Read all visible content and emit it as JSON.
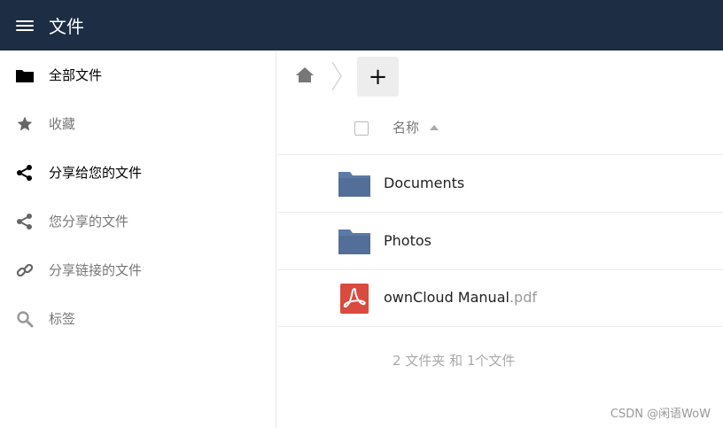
{
  "header": {
    "menu_icon": "hamburger-menu-icon",
    "title": "文件",
    "bg_color": "#1d2d44"
  },
  "sidebar": {
    "items": [
      {
        "label": "全部文件",
        "icon": "folder-icon",
        "state": "active"
      },
      {
        "label": "收藏",
        "icon": "star-icon",
        "state": "muted"
      },
      {
        "label": "分享给您的文件",
        "icon": "share-icon",
        "state": "active"
      },
      {
        "label": "您分享的文件",
        "icon": "share-icon",
        "state": "muted"
      },
      {
        "label": "分享链接的文件",
        "icon": "link-icon",
        "state": "muted"
      },
      {
        "label": "标签",
        "icon": "search-icon",
        "state": "muted"
      }
    ]
  },
  "toolbar": {
    "home_icon": "home-icon",
    "new_label": "+"
  },
  "table": {
    "name_header": "名称",
    "sort": "ascending",
    "rows": [
      {
        "name": "Documents",
        "ext": "",
        "type": "folder",
        "icon": "folder-icon"
      },
      {
        "name": "Photos",
        "ext": "",
        "type": "folder",
        "icon": "folder-icon"
      },
      {
        "name": "ownCloud Manual",
        "ext": ".pdf",
        "type": "pdf",
        "icon": "pdf-icon"
      }
    ],
    "summary": "2 文件夹 和 1个文件"
  },
  "colors": {
    "folder": "#5b7aa6",
    "pdf": "#d94a3f",
    "accent": "#1d2d44"
  },
  "watermark": "CSDN @闲语WoW"
}
